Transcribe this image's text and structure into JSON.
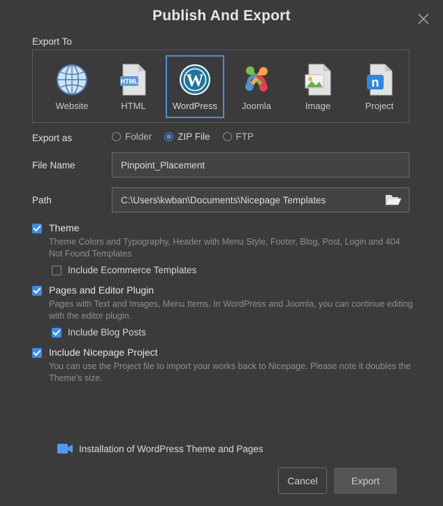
{
  "dialog": {
    "title": "Publish And Export",
    "close_icon": "close-icon"
  },
  "export_to": {
    "label": "Export To",
    "selected": "WordPress",
    "tiles": [
      {
        "label": "Website",
        "icon": "globe-icon"
      },
      {
        "label": "HTML",
        "icon": "html-file-icon"
      },
      {
        "label": "WordPress",
        "icon": "wordpress-icon"
      },
      {
        "label": "Joomla",
        "icon": "joomla-icon"
      },
      {
        "label": "Image",
        "icon": "image-file-icon"
      },
      {
        "label": "Project",
        "icon": "nicepage-project-file-icon"
      }
    ]
  },
  "export_as": {
    "label": "Export as",
    "selected": "ZIP File",
    "options": [
      {
        "label": "Folder",
        "checked": false
      },
      {
        "label": "ZIP File",
        "checked": true
      },
      {
        "label": "FTP",
        "checked": false
      }
    ]
  },
  "file_name": {
    "label": "File Name",
    "value": "Pinpoint_Placement",
    "placeholder": "File Name"
  },
  "path": {
    "label": "Path",
    "value": "C:\\Users\\kwban\\Documents\\Nicepage Templates",
    "placeholder": "Path",
    "browse_icon": "open-folder-icon"
  },
  "options": {
    "theme": {
      "title": "Theme",
      "checked": true,
      "description": "Theme Colors and Typography, Header with Menu Style, Footer, Blog, Post, Login and 404 Not Found Templates",
      "sub": {
        "label": "Include Ecommerce Templates",
        "checked": false
      }
    },
    "pages": {
      "title": "Pages and Editor Plugin",
      "checked": true,
      "description": "Pages with Text and Images, Menu Items. In WordPress and Joomla, you can continue editing with the editor plugin.",
      "sub": {
        "label": "Include Blog Posts",
        "checked": true
      }
    },
    "project": {
      "title": "Include Nicepage Project",
      "checked": true,
      "description": "You can use the Project file to import your works back to Nicepage. Please note it doubles the Theme's size."
    }
  },
  "video_link": {
    "label": "Installation of WordPress Theme and Pages",
    "icon": "video-camera-icon"
  },
  "footer": {
    "cancel_label": "Cancel",
    "export_label": "Export"
  },
  "colors": {
    "background": "#3b3b3b",
    "accent": "#3b8de8",
    "selection_border": "#4a90e2",
    "input_background": "#434343",
    "muted_text": "#8f8f8f"
  }
}
